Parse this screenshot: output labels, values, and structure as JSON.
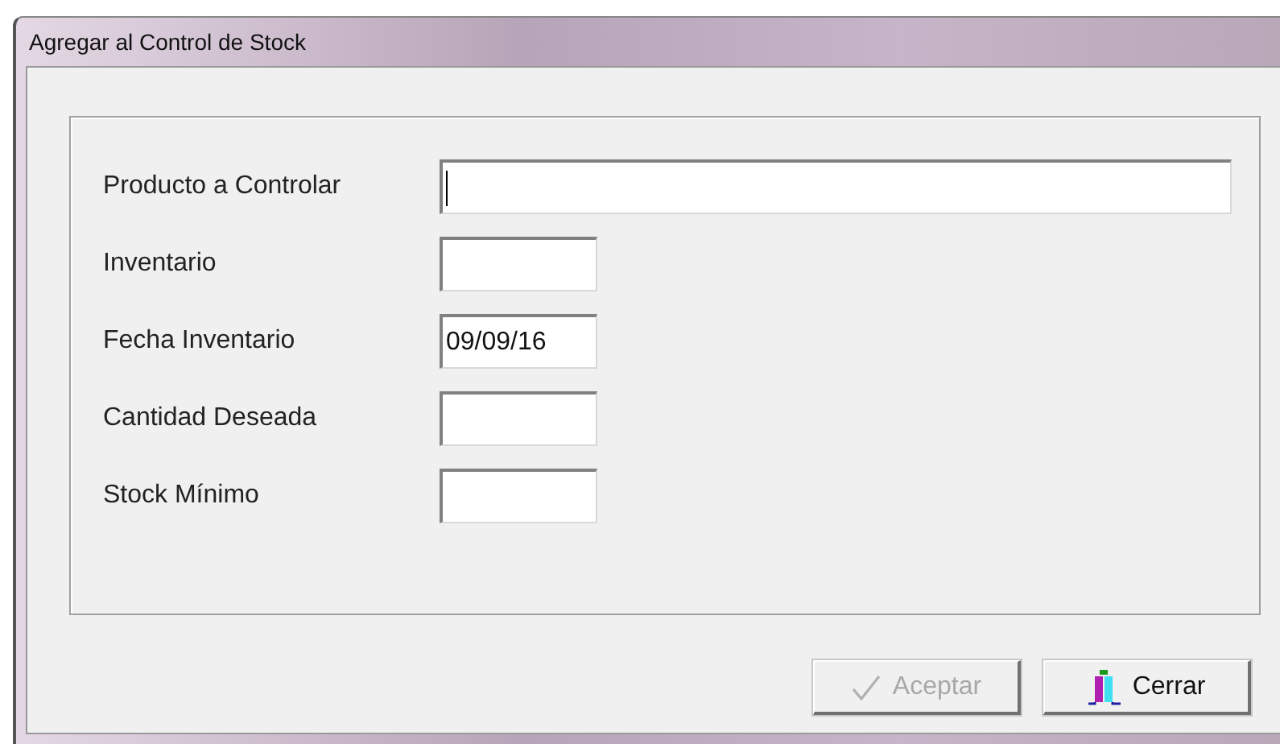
{
  "window": {
    "title": "Agregar al Control de Stock"
  },
  "fields": [
    {
      "label": "Producto a Controlar",
      "kind": "wide",
      "focused": true
    },
    {
      "label": "Inventario",
      "kind": "short",
      "focused": false
    },
    {
      "label": "Fecha Inventario",
      "kind": "short",
      "value": "09/09/16",
      "focused": false
    },
    {
      "label": "Cantidad Deseada",
      "kind": "short",
      "focused": false
    },
    {
      "label": "Stock Mínimo",
      "kind": "short",
      "focused": false
    }
  ],
  "buttons": [
    {
      "label": "Aceptar",
      "kind": "accept",
      "disabled": true
    },
    {
      "label": "Cerrar",
      "kind": "close",
      "disabled": false
    }
  ]
}
